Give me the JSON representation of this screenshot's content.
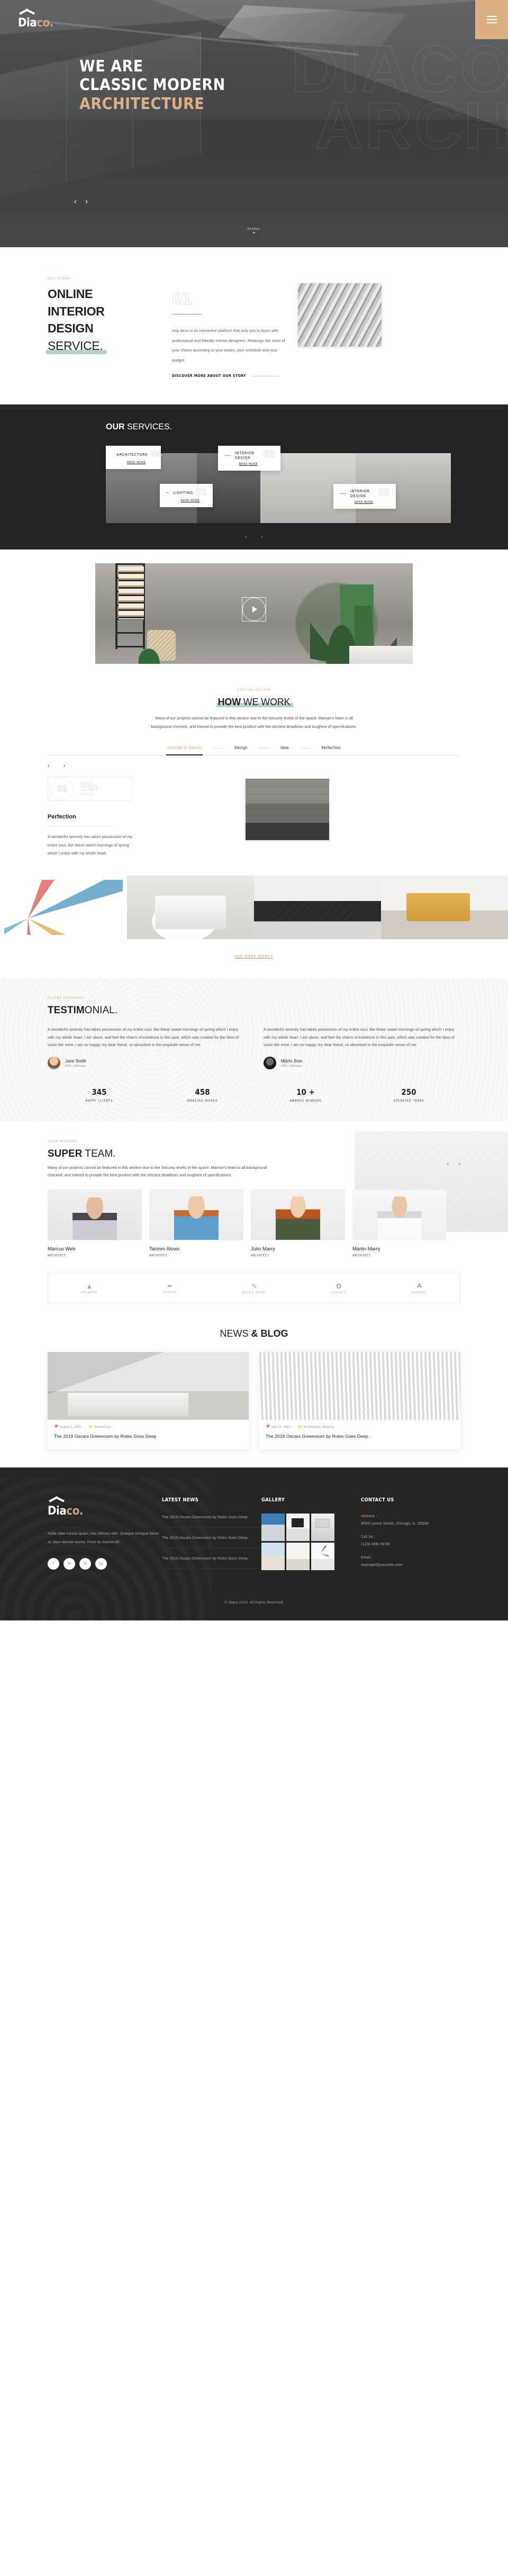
{
  "brand": {
    "name_light": "Dia",
    "name_accent": "co.",
    "logo_icon": "house-roof-icon"
  },
  "hero": {
    "line1": "WE ARE",
    "line2": "CLASSIC MODERN",
    "line3": "ARCHITECTURE",
    "watermark_line1": "DIACO",
    "watermark_line2": "ARCH",
    "prev": "‹",
    "next": "›",
    "scroll_label": "SCROLL",
    "scroll_icon": "chevron-down-icon",
    "menu_icon": "hamburger-menu-icon"
  },
  "story": {
    "eyebrow": "OUR STORY",
    "title_line1": "ONLINE",
    "title_line2": "INTERIOR",
    "title_line3": "DESIGN",
    "title_line4": "SERVICE.",
    "number": "01",
    "paragraph": "Hop deco is an interactive platform that puts you in touch with professional and friendly interior designers. Redesign the room of your choice according to your tastes, your schedule and your budget.",
    "cta": "DISCOVER MORE ABOUT OUR STORY"
  },
  "services": {
    "title_bold": "OUR",
    "title_light": " SERVICES.",
    "read_more": "READ MORE",
    "prev": "‹",
    "next": "›",
    "cards": [
      {
        "title": "ARCHITECTURE",
        "number": "04"
      },
      {
        "title": "INTERIOR DESIGN",
        "number": "02"
      },
      {
        "title": "LIGHTING",
        "number": "01"
      },
      {
        "title": "INTERIOR DESIGN",
        "number": "03"
      }
    ]
  },
  "video": {
    "play_icon": "play-triangle-icon"
  },
  "howwork": {
    "eyebrow": "SPECIALIZATION",
    "title_bold": "HOW",
    "title_light": " WE WORK",
    "description": "Many of our projects cannot be featured in this section due to the Security levels of the space. Maman's team is all background checked, and trained to provide the best product with the strictest deadlines and toughest of specifications.",
    "tabs": [
      {
        "label": "Concept & Details",
        "active": true
      },
      {
        "label": "Design",
        "active": false
      },
      {
        "label": "Idea",
        "active": false
      },
      {
        "label": "Perfection",
        "active": false
      }
    ],
    "prev": "‹",
    "next": "›",
    "panel": {
      "number": "02",
      "icon": "sofa-furniture-icon",
      "heading": "Perfection",
      "body": "A wonderful serenity has taken possession of my entire soul, like these sweet mornings of spring which I enjoy with my whole heart."
    }
  },
  "gallery": {
    "see_more": "SEE MORE WORKS"
  },
  "testimonial": {
    "eyebrow": "CLIENT FEEDBACK",
    "title_bold": "TESTIM",
    "title_light": "ONIAL.",
    "items": [
      {
        "quote": "A wonderful serenity has taken possession of my entire soul, like these sweet mornings of spring which I enjoy with my whole heart. I am alone, and feel the charm of existence in this spot, which was created for the bliss of souls like mine. I am so happy, my dear friend, so absorbed in the exquisite sense of me.",
        "name": "Jane Smith",
        "role": "CEO, InDesign"
      },
      {
        "quote": "A wonderful serenity has taken possession of my entire soul, like these sweet mornings of spring which I enjoy with my whole heart. I am alone, and feel the charm of existence in this spot, which was created for the bliss of souls like mine. I am so happy, my dear friend, so absorbed in the exquisite sense of me.",
        "name": "Mitchl Jhon",
        "role": "CEO, InDesign"
      }
    ],
    "stats": [
      {
        "number": "345",
        "label": "HAPPY CLIENTS"
      },
      {
        "number": "458",
        "label": "AMAZING WORKS"
      },
      {
        "number": "10 +",
        "label": "AWARDS WINNING"
      },
      {
        "number": "250",
        "label": "OPERATED YEARS"
      }
    ]
  },
  "team": {
    "eyebrow": "TEAM MEMBER",
    "title_bold": "SUPER",
    "title_light": " TEAM.",
    "description": "Many of our projects cannot be featured in this section due to the Security levels of the space. Maman's team is all background checked, and trained to provide the best product with the strictest deadlines and toughest of specifications.",
    "prev": "‹",
    "next": "›",
    "members": [
      {
        "name": "Marcus Web",
        "role": "ARCHITECT"
      },
      {
        "name": "Taninm Alows",
        "role": "ARCHITECT"
      },
      {
        "name": "Julio Marry",
        "role": "ARCHITECT"
      },
      {
        "name": "Martin Marry",
        "role": "ARCHITECT"
      }
    ],
    "brands": [
      {
        "glyph": "▲",
        "text": "ATLANTA"
      },
      {
        "glyph": "✒",
        "text": "VIRTUS"
      },
      {
        "glyph": "✎",
        "text": "BRIDE MAKE"
      },
      {
        "glyph": "✿",
        "text": "LEGACY"
      },
      {
        "glyph": "☘",
        "text": "PUNSHO"
      }
    ]
  },
  "news": {
    "title_light": "NEWS ",
    "title_bold": "& BLOG",
    "posts": [
      {
        "date": "August 5, 2016",
        "category": "Architecture",
        "title": "The 2019 Oscars Greenroom by Rolex Goes Deep",
        "date_icon": "calendar-icon",
        "cat_icon": "folder-icon"
      },
      {
        "date": "July 16, 2019",
        "category": "Architecture, Building",
        "title": "The 2019 Oscars Greenroom by Rolex Goes Deep.",
        "date_icon": "calendar-icon",
        "cat_icon": "folder-icon"
      }
    ]
  },
  "footer": {
    "about": "Nulla vitae cursus quam, nec ultrices nibh. Quisque tristique lorem ac diam laoreet auctor. Proin ac massa elit.",
    "socials": [
      {
        "icon": "facebook-icon",
        "glyph": "f"
      },
      {
        "icon": "twitter-icon",
        "glyph": "✉"
      },
      {
        "icon": "linkedin-icon",
        "glyph": "in"
      },
      {
        "icon": "instagram-icon",
        "glyph": "◎"
      }
    ],
    "latest_news": {
      "heading": "LATEST NEWS",
      "items": [
        "The 2019 Oscars Greenroom by Rolex Goes Deep",
        "The 2019 Oscars Greenroom by Rolex Goes Deep.",
        "The 2019 Oscars Greenroom by Rolex Goes Deep."
      ]
    },
    "gallery": {
      "heading": "GALLERY"
    },
    "contact": {
      "heading": "CONTACT US",
      "address_label": "Address :",
      "address_value": "8500 Lorem Street, Chicago, IL. 55030",
      "phone_label": "Call Us :",
      "phone_value": "(123) 456-78-90",
      "email_label": "Email :",
      "email_value": "example@yoursite.com"
    },
    "copyright_prefix": "© ",
    "copyright_brand": "diaco",
    "copyright_suffix": " 2019. All Rights Reserved."
  },
  "colors": {
    "accent": "#c9a177",
    "gold": "#d9b184",
    "dark": "#232323",
    "mint": "#a8cdbb"
  }
}
